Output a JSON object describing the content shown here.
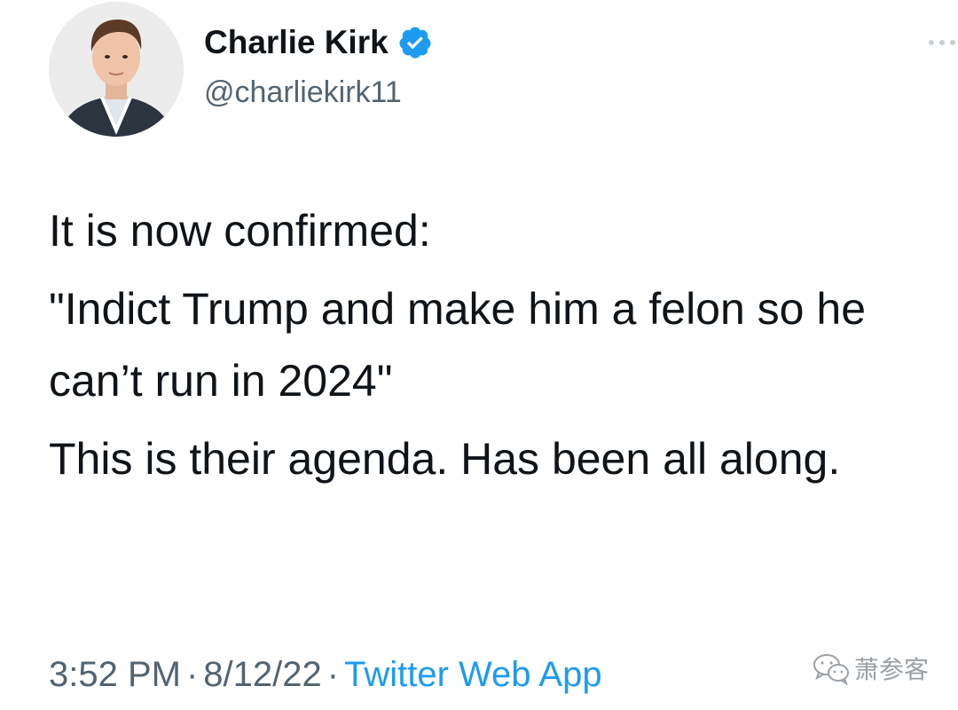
{
  "tweet": {
    "author": {
      "name": "Charlie Kirk",
      "handle": "@charliekirk11",
      "verified": true
    },
    "paragraphs": [
      "It is now confirmed:",
      "\"Indict Trump and make him a felon so he can’t run in 2024\"",
      "This is their agenda. Has been all along."
    ],
    "time": "3:52 PM",
    "date": "8/12/22",
    "separator": "·",
    "source": "Twitter Web App"
  },
  "watermark": {
    "text": "萧参客",
    "icon": "wechat-icon"
  },
  "colors": {
    "text": "#0f1419",
    "secondary": "#536471",
    "link": "#1d9bf0",
    "verified": "#1d9bf0"
  }
}
